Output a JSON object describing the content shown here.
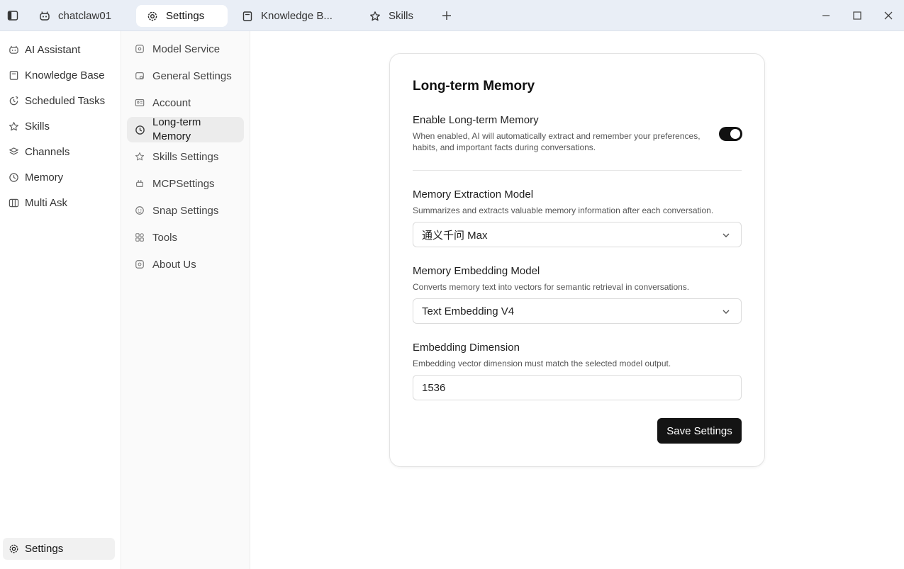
{
  "tabs": [
    {
      "label": "chatclaw01",
      "icon": "bot-icon"
    },
    {
      "label": "Settings",
      "icon": "gear-icon"
    },
    {
      "label": "Knowledge B...",
      "icon": "book-icon"
    },
    {
      "label": "Skills",
      "icon": "star-icon"
    }
  ],
  "sidebar": {
    "items": [
      {
        "label": "AI Assistant",
        "icon": "bot-icon"
      },
      {
        "label": "Knowledge Base",
        "icon": "book-icon"
      },
      {
        "label": "Scheduled Tasks",
        "icon": "clock-refresh-icon"
      },
      {
        "label": "Skills",
        "icon": "star-icon"
      },
      {
        "label": "Channels",
        "icon": "channels-icon"
      },
      {
        "label": "Memory",
        "icon": "clock-icon"
      },
      {
        "label": "Multi Ask",
        "icon": "columns-icon"
      }
    ],
    "settings_label": "Settings"
  },
  "settings_nav": {
    "items": [
      {
        "label": "Model Service",
        "icon": "model-icon"
      },
      {
        "label": "General Settings",
        "icon": "sliders-icon"
      },
      {
        "label": "Account",
        "icon": "id-card-icon"
      },
      {
        "label": "Long-term Memory",
        "icon": "clock-icon"
      },
      {
        "label": "Skills Settings",
        "icon": "star-icon"
      },
      {
        "label": "MCPSettings",
        "icon": "plug-icon"
      },
      {
        "label": "Snap Settings",
        "icon": "snap-icon"
      },
      {
        "label": "Tools",
        "icon": "tools-icon"
      },
      {
        "label": "About Us",
        "icon": "info-icon"
      }
    ],
    "active_index": 3
  },
  "card": {
    "title": "Long-term Memory",
    "enable": {
      "label": "Enable Long-term Memory",
      "desc_line1": "When enabled, AI will automatically extract and remember your preferences,",
      "desc_line2": "habits, and important facts during conversations.",
      "enabled": true
    },
    "extraction": {
      "label": "Memory Extraction Model",
      "desc": "Summarizes and extracts valuable memory information after each conversation.",
      "value": "通义千问 Max"
    },
    "embedding": {
      "label": "Memory Embedding Model",
      "desc": "Converts memory text into vectors for semantic retrieval in conversations.",
      "value": "Text Embedding V4"
    },
    "dimension": {
      "label": "Embedding Dimension",
      "desc": "Embedding vector dimension must match the selected model output.",
      "value": "1536"
    },
    "save_label": "Save Settings"
  },
  "colors": {
    "titlebar_bg": "#e9eef6",
    "accent_dark": "#141414",
    "active_item_bg": "#ececec"
  }
}
